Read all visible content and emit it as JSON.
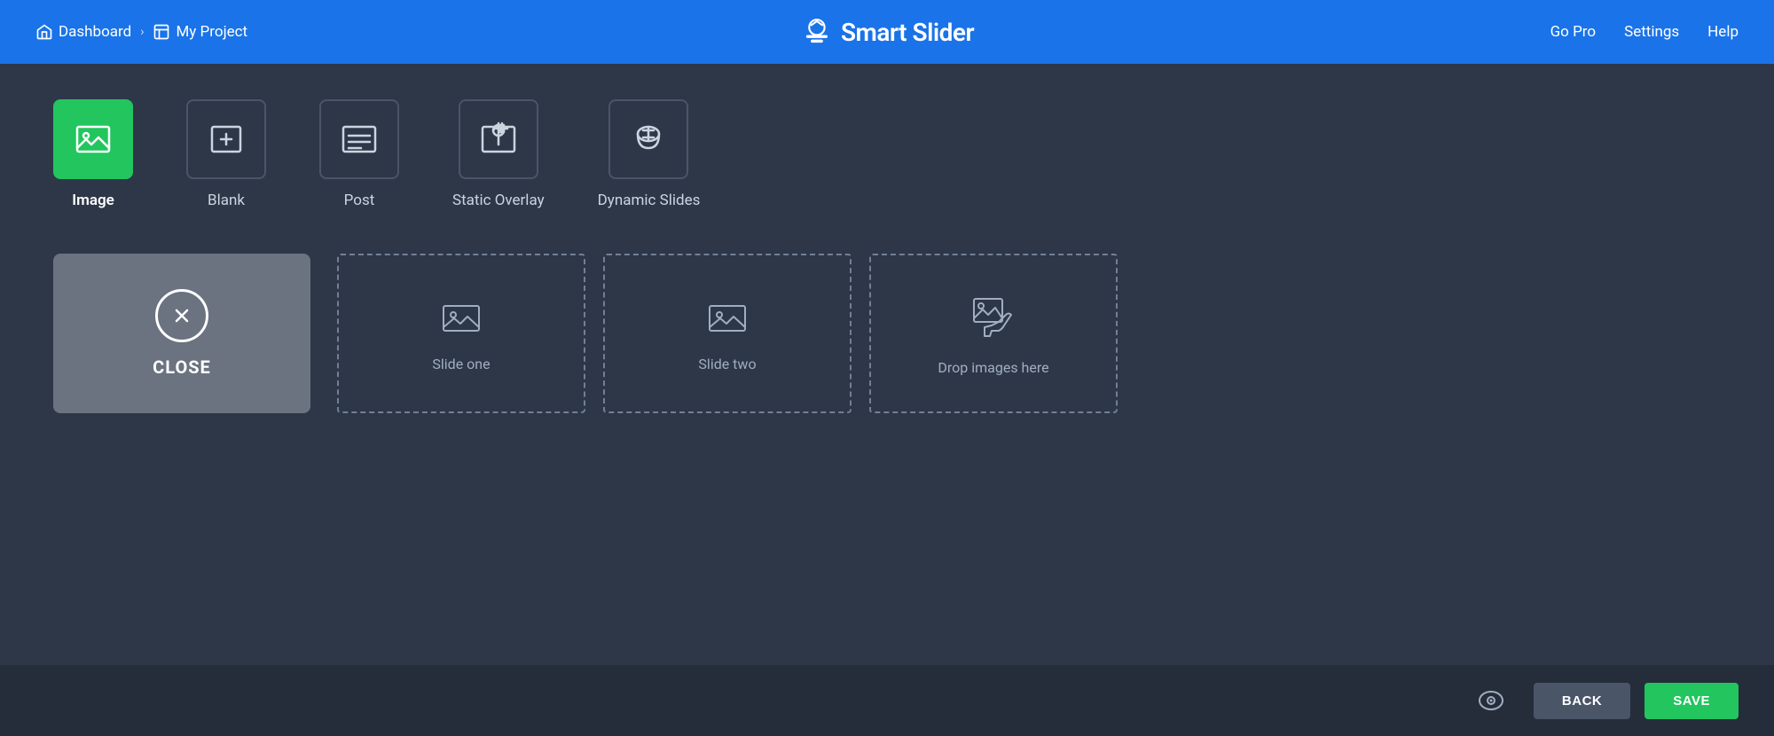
{
  "header": {
    "dashboard_label": "Dashboard",
    "project_label": "My Project",
    "logo_text": "Smart Slider",
    "go_pro": "Go Pro",
    "settings": "Settings",
    "help": "Help"
  },
  "slide_types": [
    {
      "id": "image",
      "label": "Image",
      "active": true
    },
    {
      "id": "blank",
      "label": "Blank",
      "active": false
    },
    {
      "id": "post",
      "label": "Post",
      "active": false
    },
    {
      "id": "static-overlay",
      "label": "Static Overlay",
      "active": false
    },
    {
      "id": "dynamic-slides",
      "label": "Dynamic Slides",
      "active": false
    }
  ],
  "slides": [
    {
      "id": "close",
      "label": "CLOSE"
    },
    {
      "id": "slide-one",
      "label": "Slide one"
    },
    {
      "id": "slide-two",
      "label": "Slide two"
    },
    {
      "id": "drop",
      "label": "Drop images here"
    }
  ],
  "footer": {
    "back_label": "BACK",
    "save_label": "SAVE"
  }
}
